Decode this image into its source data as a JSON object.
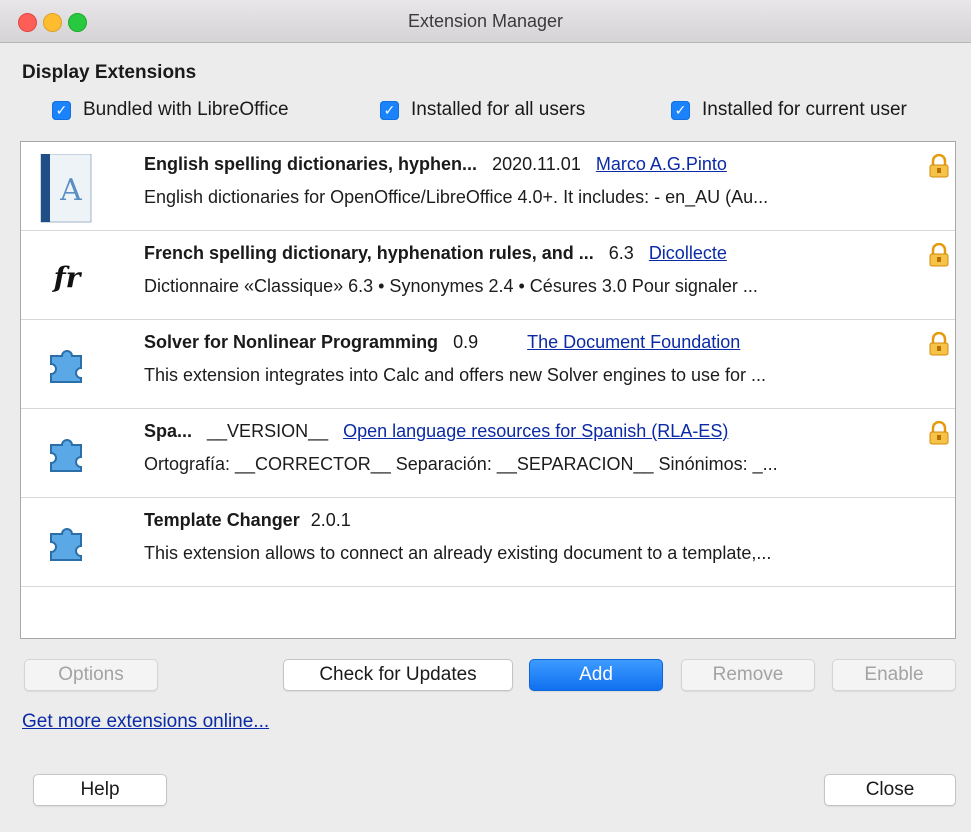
{
  "window": {
    "title": "Extension Manager"
  },
  "display": {
    "heading": "Display Extensions",
    "filters": [
      {
        "label": "Bundled with LibreOffice",
        "checked": true
      },
      {
        "label": "Installed for all users",
        "checked": true
      },
      {
        "label": "Installed for current user",
        "checked": true
      }
    ]
  },
  "extensions": [
    {
      "icon": "dictionary-book-icon",
      "name": "English spelling dictionaries, hyphen...",
      "version": "2020.11.01",
      "publisher": "Marco A.G.Pinto",
      "description": "English dictionaries for OpenOffice/LibreOffice 4.0+.  It includes: - en_AU (Au...",
      "locked": true
    },
    {
      "icon": "french-fr-icon",
      "icon_text": "fr",
      "name": "French spelling dictionary, hyphenation rules, and ...",
      "version": "6.3",
      "publisher": "Dicollecte",
      "description": "Dictionnaire «Classique» 6.3 • Synonymes 2.4 • Césures 3.0   Pour signaler ...",
      "locked": true
    },
    {
      "icon": "puzzle-piece-icon",
      "name": "Solver for Nonlinear Programming",
      "version": "0.9",
      "publisher": "The Document Foundation",
      "description": "This extension integrates into Calc and offers new Solver engines to use for ...",
      "locked": true
    },
    {
      "icon": "puzzle-piece-icon",
      "name": "Spa...",
      "version": "__VERSION__",
      "publisher": "Open language resources for Spanish (RLA-ES)",
      "description": "Ortografía: __CORRECTOR__  Separación: __SEPARACION__  Sinónimos: _...",
      "locked": true
    },
    {
      "icon": "puzzle-piece-icon",
      "name": "Template Changer",
      "version": "2.0.1",
      "publisher": "",
      "description": "This extension allows to connect an already existing document to a template,...",
      "locked": false
    }
  ],
  "buttons": {
    "options": "Options",
    "check_updates": "Check for Updates",
    "add": "Add",
    "remove": "Remove",
    "enable": "Enable",
    "help": "Help",
    "close": "Close"
  },
  "more_link": "Get more extensions online...",
  "colors": {
    "accent": "#1a82fb",
    "link": "#0b2aa6",
    "lock": "#e59a0b",
    "puzzle": "#3f95d6"
  }
}
